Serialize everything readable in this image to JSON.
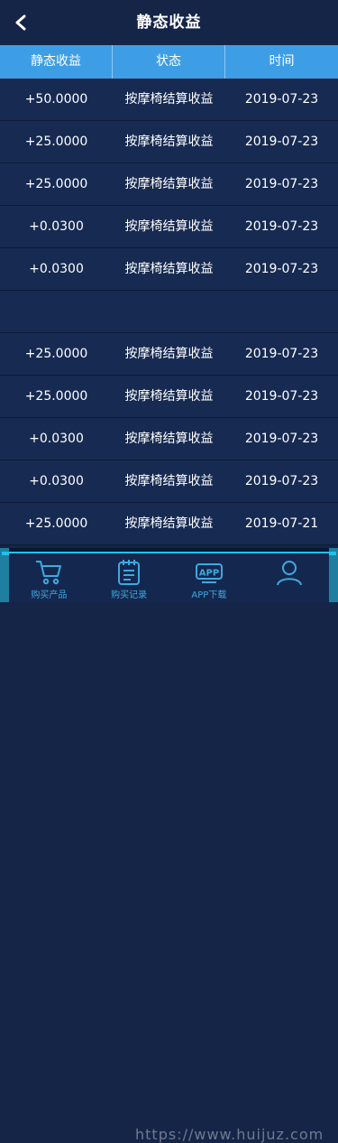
{
  "header": {
    "title": "静态收益"
  },
  "columns": [
    "静态收益",
    "状态",
    "时间"
  ],
  "rows": [
    {
      "amount": "+50.0000",
      "status": "按摩椅结算收益",
      "date": "2019-07-23"
    },
    {
      "amount": "+25.0000",
      "status": "按摩椅结算收益",
      "date": "2019-07-23"
    },
    {
      "amount": "+25.0000",
      "status": "按摩椅结算收益",
      "date": "2019-07-23"
    },
    {
      "amount": "+0.0300",
      "status": "按摩椅结算收益",
      "date": "2019-07-23"
    },
    {
      "amount": "+0.0300",
      "status": "按摩椅结算收益",
      "date": "2019-07-23"
    },
    {
      "amount": "",
      "status": "",
      "date": ""
    },
    {
      "amount": "+25.0000",
      "status": "按摩椅结算收益",
      "date": "2019-07-23"
    },
    {
      "amount": "+25.0000",
      "status": "按摩椅结算收益",
      "date": "2019-07-23"
    },
    {
      "amount": "+0.0300",
      "status": "按摩椅结算收益",
      "date": "2019-07-23"
    },
    {
      "amount": "+0.0300",
      "status": "按摩椅结算收益",
      "date": "2019-07-23"
    },
    {
      "amount": "+25.0000",
      "status": "按摩椅结算收益",
      "date": "2019-07-21"
    }
  ],
  "nav": [
    {
      "label": "购买产品",
      "icon": "cart-icon"
    },
    {
      "label": "购买记录",
      "icon": "notebook-icon"
    },
    {
      "label": "APP下载",
      "icon": "app-icon"
    },
    {
      "label": "",
      "icon": "user-icon"
    }
  ],
  "watermark": "https://www.huijuz.com",
  "colors": {
    "background": "#152548",
    "header_bar": "#3d9ee6",
    "accent": "#1fc3e6",
    "nav_text": "#3ea9e0"
  }
}
